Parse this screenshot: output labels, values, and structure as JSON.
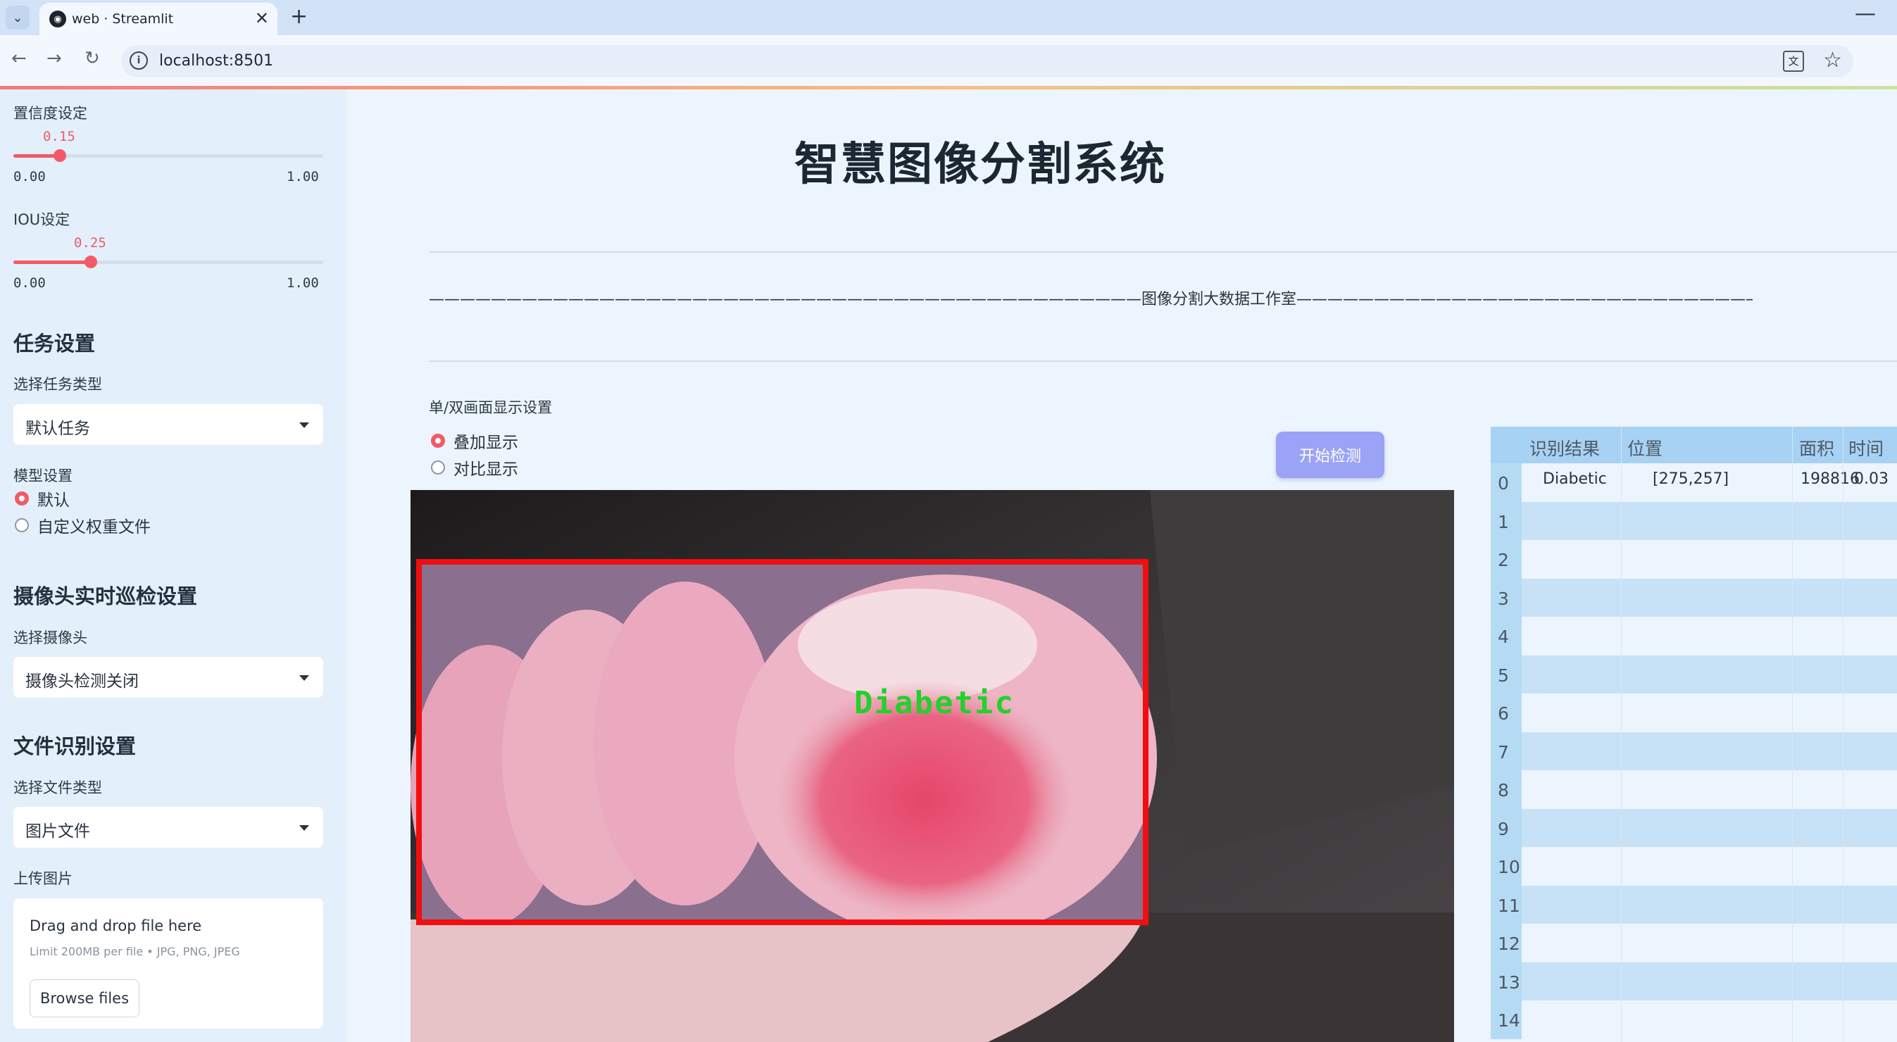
{
  "browser": {
    "tab_title": "web · Streamlit",
    "url": "localhost:8501",
    "icons": [
      "tab-menu-icon",
      "streamlit-favicon",
      "close-icon",
      "plus-icon",
      "minimize-icon",
      "back-arrow-icon",
      "forward-arrow-icon",
      "reload-icon",
      "info-icon",
      "translate-icon",
      "star-icon"
    ],
    "tab_close": "✕",
    "new_tab": "+",
    "minimize": "—",
    "back": "←",
    "forward": "→",
    "reload": "↻",
    "tab_menu": "⌄",
    "info": "i",
    "translate": "文",
    "star": "☆"
  },
  "sidebar": {
    "confidence": {
      "label": "置信度设定",
      "value": "0.15",
      "level": 0.15,
      "min": "0.00",
      "max": "1.00"
    },
    "iou": {
      "label": "IOU设定",
      "value": "0.25",
      "level": 0.25,
      "min": "0.00",
      "max": "1.00"
    },
    "task": {
      "heading": "任务设置",
      "label": "选择任务类型",
      "selected": "默认任务"
    },
    "model": {
      "label": "模型设置",
      "options": [
        "默认",
        "自定义权重文件"
      ],
      "selected_index": 0
    },
    "camera": {
      "heading": "摄像头实时巡检设置",
      "label": "选择摄像头",
      "selected": "摄像头检测关闭"
    },
    "file": {
      "heading": "文件识别设置",
      "label": "选择文件类型",
      "selected": "图片文件"
    },
    "upload": {
      "label": "上传图片",
      "title": "Drag and drop file here",
      "limit": "Limit 200MB per file • JPG, PNG, JPEG",
      "button": "Browse files"
    }
  },
  "main": {
    "title": "智慧图像分割系统",
    "divider_text": "——————————————————————————————————————————————图像分割大数据工作室——————————————————————————————————————————————",
    "display_label": "单/双画面显示设置",
    "display_options": [
      "叠加显示",
      "对比显示"
    ],
    "display_selected_index": 0,
    "start_button": "开始检测",
    "detection_label": "Diabetic",
    "colors": {
      "accent": "#f25b66",
      "box": "#f10d10",
      "label": "#22d12a",
      "button": "#9aa3f6"
    }
  },
  "table": {
    "columns": [
      "识别结果",
      "位置",
      "面积",
      "时间"
    ],
    "rows": [
      {
        "index": "0",
        "result": "Diabetic",
        "position": "[275,257]",
        "area": "198816",
        "time": "0.03"
      },
      {
        "index": "1"
      },
      {
        "index": "2"
      },
      {
        "index": "3"
      },
      {
        "index": "4"
      },
      {
        "index": "5"
      },
      {
        "index": "6"
      },
      {
        "index": "7"
      },
      {
        "index": "8"
      },
      {
        "index": "9"
      },
      {
        "index": "10"
      },
      {
        "index": "11"
      },
      {
        "index": "12"
      },
      {
        "index": "13"
      },
      {
        "index": "14"
      }
    ]
  }
}
